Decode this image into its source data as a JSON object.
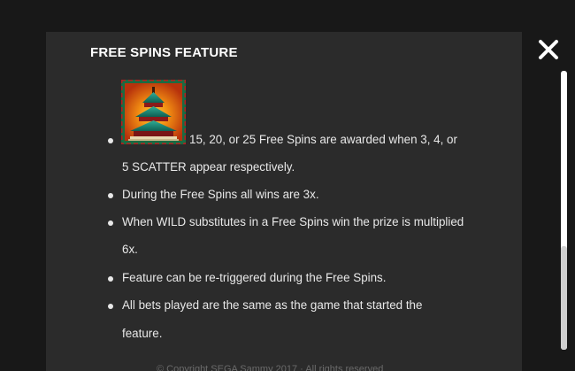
{
  "panel": {
    "title": "FREE SPINS FEATURE",
    "symbol_icon": "pagoda-scatter-symbol",
    "items": [
      {
        "line1": "15, 20, or 25 Free Spins are awarded when 3, 4, or",
        "line2": "5 SCATTER appear respectively."
      },
      {
        "line1": "During the Free Spins all wins are 3x."
      },
      {
        "line1": "When WILD substitutes in a Free Spins win the prize is multiplied",
        "line2": "6x."
      },
      {
        "line1": "Feature can be re-triggered during the Free Spins."
      },
      {
        "line1": "All bets played are the same as the game that started the",
        "line2": "feature."
      }
    ],
    "footer": "© Copyright SEGA Sammy 2017 · All rights reserved"
  },
  "close_button": {
    "icon": "close-icon"
  },
  "scrollbar": {
    "position": 0.63
  },
  "colors": {
    "background": "#181818",
    "panel": "#2b2b2b",
    "text": "#e8e8e8",
    "title": "#ffffff"
  }
}
